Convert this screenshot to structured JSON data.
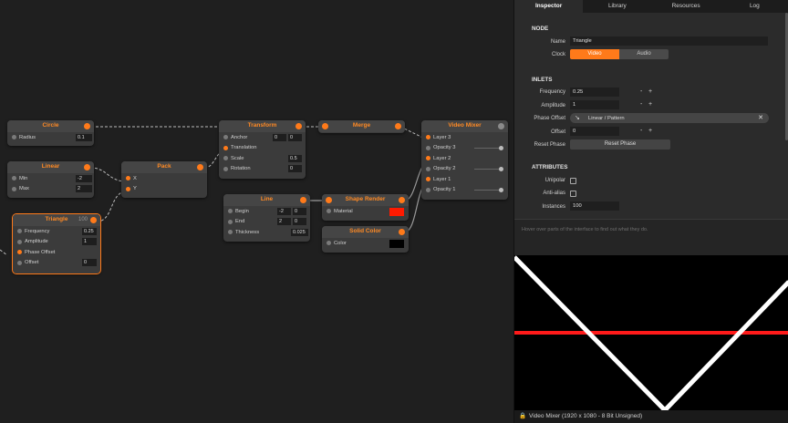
{
  "graph": {
    "circle": {
      "title": "Circle",
      "radius_label": "Radius",
      "radius": "0.1"
    },
    "linear": {
      "title": "Linear",
      "min_label": "Min",
      "min": "-2",
      "max_label": "Max",
      "max": "2"
    },
    "triangle": {
      "title": "Triangle",
      "count": "100",
      "frequency_label": "Frequency",
      "frequency": "0.25",
      "amplitude_label": "Amplitude",
      "amplitude": "1",
      "phase_offset_label": "Phase Offset",
      "offset_label": "Offset",
      "offset": "0"
    },
    "pack": {
      "title": "Pack",
      "x_label": "X",
      "y_label": "Y"
    },
    "transform": {
      "title": "Transform",
      "anchor_label": "Anchor",
      "anchor_x": "0",
      "anchor_y": "0",
      "translation_label": "Translation",
      "scale_label": "Scale",
      "scale": "0.5",
      "rotation_label": "Rotation",
      "rotation": "0"
    },
    "merge": {
      "title": "Merge"
    },
    "video_mixer": {
      "title": "Video Mixer",
      "layer3": "Layer 3",
      "opacity3": "Opacity 3",
      "layer2": "Layer 2",
      "opacity2": "Opacity 2",
      "layer1": "Layer 1",
      "opacity1": "Opacity 1"
    },
    "line": {
      "title": "Line",
      "begin_label": "Begin",
      "begin_x": "-2",
      "begin_y": "0",
      "end_label": "End",
      "end_x": "2",
      "end_y": "0",
      "thickness_label": "Thickness",
      "thickness": "0.025"
    },
    "shape_render": {
      "title": "Shape Render",
      "material_label": "Material"
    },
    "solid_color": {
      "title": "Solid Color",
      "color_label": "Color"
    }
  },
  "colors": {
    "accent": "#ff7a1a",
    "material_swatch": "#ff1a00",
    "color_swatch": "#000000",
    "preview_line": "#ff1a1a"
  },
  "panel": {
    "tabs": [
      "Inspector",
      "Library",
      "Resources",
      "Log"
    ],
    "node_header": "NODE",
    "name_label": "Name",
    "name_value": "Triangle",
    "clock_label": "Clock",
    "clock_options": [
      "Video",
      "Audio"
    ],
    "clock_selected": "Video",
    "inlets_header": "INLETS",
    "frequency_label": "Frequency",
    "frequency": "0.25",
    "amplitude_label": "Amplitude",
    "amplitude": "1",
    "phase_offset_label": "Phase Offset",
    "phase_offset_link": "Linear / Pattern",
    "offset_label": "Offset",
    "offset": "0",
    "reset_phase_label": "Reset Phase",
    "reset_phase_button": "Reset Phase",
    "attributes_header": "ATTRIBUTES",
    "unipolar_label": "Unipolar",
    "antialias_label": "Anti-alias",
    "instances_label": "Instances",
    "instances": "100",
    "minus": "-",
    "plus": "+",
    "help_text": "Hover over parts of the interface to find out what they do.",
    "status_text": "Video Mixer (1920 x 1080 - 8 Bit Unsigned)"
  }
}
